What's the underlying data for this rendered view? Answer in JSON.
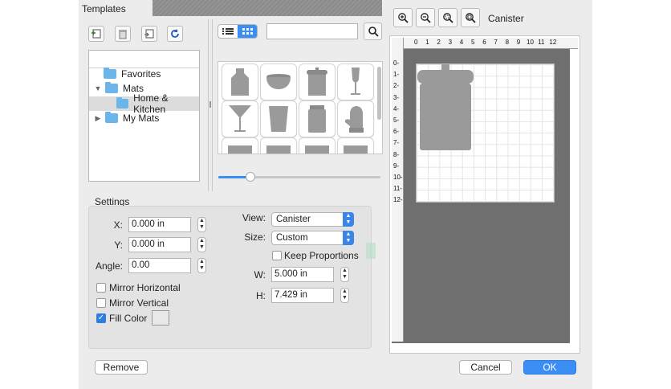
{
  "window": {
    "tab_title": "Templates"
  },
  "toolbar_left": {
    "icons": [
      "new-template-icon",
      "trash-icon",
      "import-icon",
      "refresh-icon"
    ]
  },
  "tree": {
    "items": [
      {
        "label": "Favorites",
        "expanded": null
      },
      {
        "label": "Mats",
        "expanded": true
      },
      {
        "label": "Home & Kitchen",
        "selected": true
      },
      {
        "label": "My Mats",
        "expanded": false
      }
    ]
  },
  "view_toggle": {
    "list_icon": "list-view-icon",
    "grid_icon": "grid-view-icon",
    "active": "grid"
  },
  "search": {
    "value": "",
    "placeholder": ""
  },
  "gallery": {
    "items": [
      "apron",
      "bowl",
      "canister",
      "wine-glass",
      "martini-glass",
      "tumbler",
      "jar",
      "oven-mitt",
      "sheet-1",
      "sheet-2",
      "sheet-3",
      "sheet-4"
    ],
    "slider_value": 0.2
  },
  "settings": {
    "title": "Settings",
    "x_label": "X:",
    "x_value": "0.000 in",
    "y_label": "Y:",
    "y_value": "0.000 in",
    "angle_label": "Angle:",
    "angle_value": "0.00",
    "mirror_h_label": "Mirror Horizontal",
    "mirror_h": false,
    "mirror_v_label": "Mirror Vertical",
    "mirror_v": false,
    "fill_label": "Fill Color",
    "fill": true,
    "view_label": "View:",
    "view_value": "Canister",
    "size_label": "Size:",
    "size_value": "Custom",
    "keep_label": "Keep Proportions",
    "keep": false,
    "w_label": "W:",
    "w_value": "5.000 in",
    "h_label": "H:",
    "h_value": "7.429 in"
  },
  "preview": {
    "title": "Canister",
    "zoom_icons": [
      "zoom-in-icon",
      "zoom-out-icon",
      "zoom-fit-icon",
      "zoom-actual-icon"
    ],
    "ruler_top": [
      "0",
      "1",
      "2",
      "3",
      "4",
      "5",
      "6",
      "7",
      "8",
      "9",
      "10",
      "11",
      "12"
    ],
    "ruler_left": [
      "0",
      "1",
      "2",
      "3",
      "4",
      "5",
      "6",
      "7",
      "8",
      "9",
      "10",
      "11",
      "12"
    ]
  },
  "buttons": {
    "remove": "Remove",
    "cancel": "Cancel",
    "ok": "OK"
  },
  "colors": {
    "accent": "#3a8ef4",
    "folder": "#6cb5ea",
    "shape": "#9a9a9a"
  }
}
